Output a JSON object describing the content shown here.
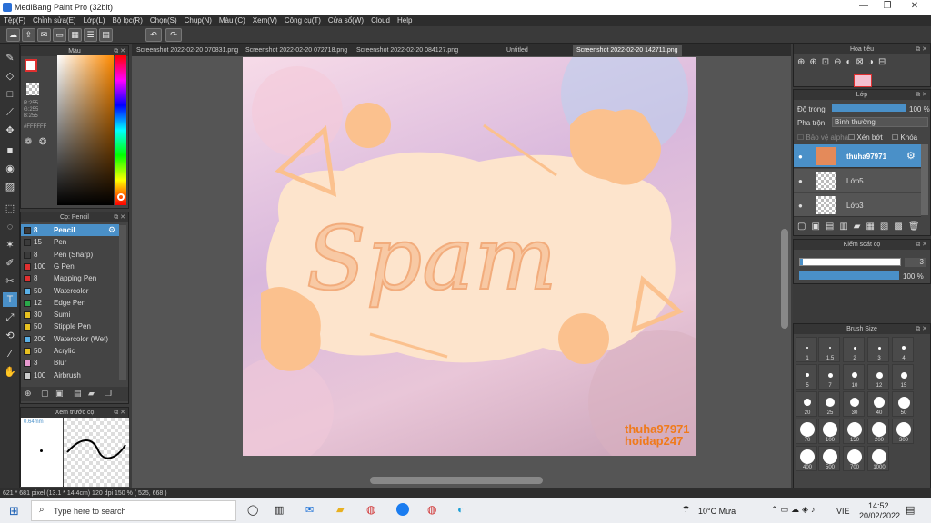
{
  "window": {
    "title": "MediBang Paint Pro (32bit)",
    "controls": [
      "—",
      "❐",
      "✕"
    ]
  },
  "menu": [
    "Tệp(F)",
    "Chỉnh sửa(E)",
    "Lớp(L)",
    "Bộ lọc(R)",
    "Chọn(S)",
    "Chụp(N)",
    "Màu (C)",
    "Xem(V)",
    "Công cụ(T)",
    "Cửa sổ(W)",
    "Cloud",
    "Help"
  ],
  "color_panel": {
    "title": "Màu",
    "r": "R:255",
    "g": "G:255",
    "b": "B:255",
    "hex": "#FFFFFF"
  },
  "brush_panel": {
    "title": "Cọ: Pencil",
    "items": [
      {
        "size": "8",
        "name": "Pencil",
        "color": "#3b3b3b",
        "selected": true
      },
      {
        "size": "15",
        "name": "Pen",
        "color": "#3b3b3b"
      },
      {
        "size": "8",
        "name": "Pen (Sharp)",
        "color": "#3b3b3b"
      },
      {
        "size": "100",
        "name": "G Pen",
        "color": "#e03030"
      },
      {
        "size": "8",
        "name": "Mapping Pen",
        "color": "#e03030"
      },
      {
        "size": "50",
        "name": "Watercolor",
        "color": "#5ab0e6"
      },
      {
        "size": "12",
        "name": "Edge Pen",
        "color": "#2aa84a"
      },
      {
        "size": "30",
        "name": "Sumi",
        "color": "#e6c020"
      },
      {
        "size": "50",
        "name": "Stipple Pen",
        "color": "#e6c020"
      },
      {
        "size": "200",
        "name": "Watercolor (Wet)",
        "color": "#5ab0e6"
      },
      {
        "size": "50",
        "name": "Acrylic",
        "color": "#e6c020"
      },
      {
        "size": "3",
        "name": "Blur",
        "color": "#e89ad0"
      },
      {
        "size": "100",
        "name": "Airbrush",
        "color": "#cccccc"
      }
    ]
  },
  "preview_panel": {
    "title": "Xem trước cọ",
    "size": "0.64mm"
  },
  "tabs": [
    "Screenshot 2022-02-20 070831.png",
    "Screenshot 2022-02-20 072718.png",
    "Screenshot 2022-02-20 084127.png",
    "Untitled",
    "Screenshot 2022-02-20 142711.png"
  ],
  "art": {
    "lettering": "Spam",
    "watermark1": "thuha97971",
    "watermark2": "hoidap247"
  },
  "navigator": {
    "title": "Hoa tiêu"
  },
  "layer_panel": {
    "title": "Lớp",
    "opacity_label": "Độ trong",
    "opacity_value": "100 %",
    "blend_label": "Pha trộn",
    "blend_value": "Bình thường",
    "protect_alpha": "Bảo vệ alpha",
    "clipping": "Xén bớt",
    "lock": "Khóa",
    "layers": [
      "thuha97971",
      "Lớp5",
      "Lớp3"
    ]
  },
  "brush_control": {
    "title": "Kiểm soát cọ",
    "size": "3",
    "opacity": "100 %"
  },
  "brush_size": {
    "title": "Brush Size",
    "sizes": [
      "1",
      "1.5",
      "2",
      "3",
      "4",
      "5",
      "7",
      "10",
      "12",
      "15",
      "20",
      "25",
      "30",
      "40",
      "50",
      "70",
      "100",
      "150",
      "200",
      "300",
      "400",
      "500",
      "700",
      "1000"
    ]
  },
  "status": {
    "text": "621 * 681 pixel   (13.1 * 14.4cm)   120 dpi   150 %   ( 525, 668 )"
  },
  "taskbar": {
    "search": "Type here to search",
    "weather": "10°C  Mưa",
    "lang": "VIE",
    "time": "14:52",
    "date": "20/02/2022"
  }
}
